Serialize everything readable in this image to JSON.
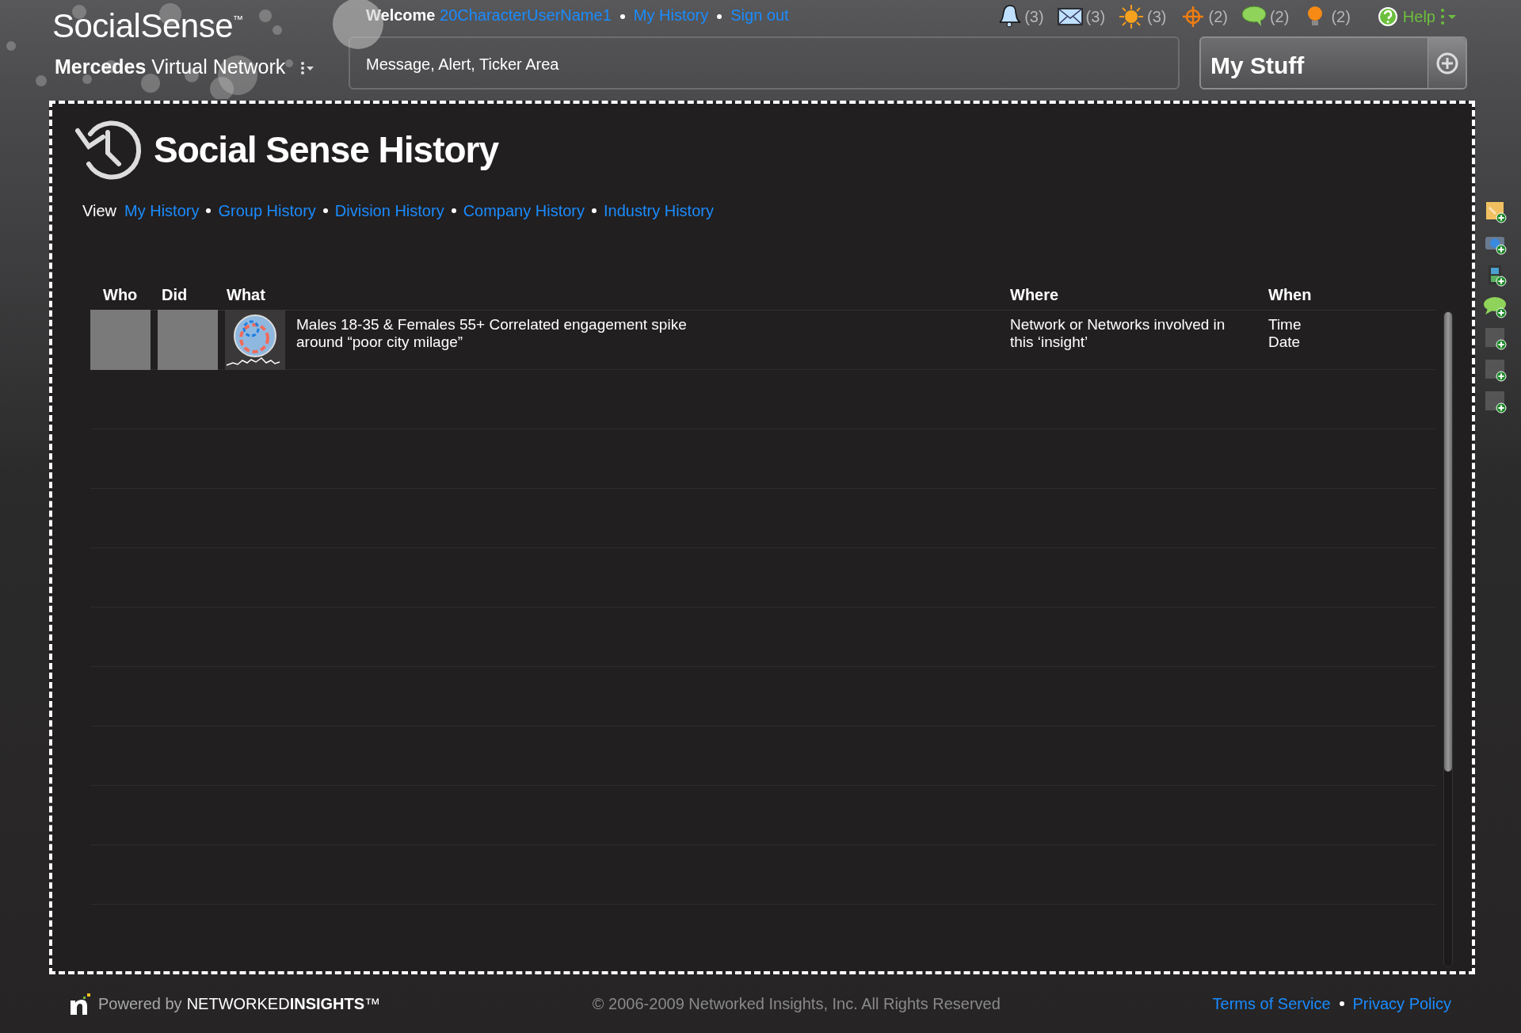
{
  "brand": {
    "name": "SocialSense",
    "tm": "™",
    "network": "**Mercedes** Virtual Network"
  },
  "welcome": {
    "label": "Welcome",
    "user": "20CharacterUserName1",
    "links": [
      "My History",
      "Sign out"
    ]
  },
  "ticker": {
    "text": "Message, Alert, Ticker Area"
  },
  "notifications": [
    {
      "kind": "bell",
      "count": "(3)"
    },
    {
      "kind": "mail",
      "count": "(3)"
    },
    {
      "kind": "sun",
      "count": "(3)"
    },
    {
      "kind": "target",
      "count": "(2)"
    },
    {
      "kind": "chat",
      "count": "(2)"
    },
    {
      "kind": "bulb",
      "count": "(2)"
    }
  ],
  "help": {
    "label": "Help"
  },
  "my_stuff": {
    "title": "My Stuff"
  },
  "page": {
    "title": "Social Sense History",
    "view_label": "View",
    "view_links": [
      "My History",
      "Group History",
      "Division History",
      "Company History",
      "Industry History"
    ]
  },
  "table": {
    "columns": [
      "Who",
      "Did",
      "What",
      "Where",
      "When"
    ],
    "rows": [
      {
        "what": "Males 18-35 & Females 55+ Correlated engagement spike around “poor city milage”",
        "where": "Network or Networks involved in this ‘insight’",
        "when": [
          "Time",
          "Date"
        ]
      }
    ]
  },
  "widgets": [
    {
      "kind": "note"
    },
    {
      "kind": "camera"
    },
    {
      "kind": "film"
    },
    {
      "kind": "chat"
    },
    {
      "kind": "blank"
    },
    {
      "kind": "blank"
    },
    {
      "kind": "blank"
    }
  ],
  "footer": {
    "powered": "Powered by",
    "company": "NETWORKED**INSIGHTS**™",
    "copyright": "© 2006-2009 Networked Insights, Inc. All Rights Reserved",
    "links": [
      "Terms of Service",
      "Privacy Policy"
    ]
  }
}
